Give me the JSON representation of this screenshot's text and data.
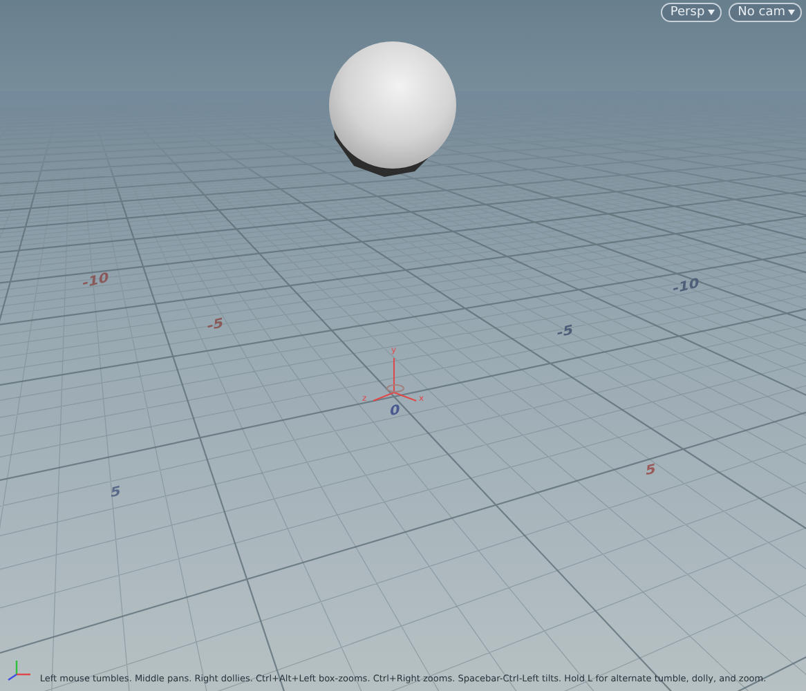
{
  "view_menus": [
    {
      "label": "Persp"
    },
    {
      "label": "No cam"
    }
  ],
  "grid_labels": [
    {
      "text": "-10",
      "color": "#8a5a5a"
    },
    {
      "text": "-5",
      "color": "#8a5a5a"
    },
    {
      "text": "5",
      "color": "#9a5a5a"
    },
    {
      "text": "-10",
      "color": "#4f5f7a"
    },
    {
      "text": "-5",
      "color": "#4f5f7a"
    },
    {
      "text": "5",
      "color": "#5a6a8a"
    },
    {
      "text": "0",
      "color": "#4a5a90"
    }
  ],
  "origin_axes": [
    {
      "text": "y"
    },
    {
      "text": "x"
    },
    {
      "text": "z"
    }
  ],
  "hint": "Left mouse tumbles. Middle pans. Right dollies. Ctrl+Alt+Left box-zooms. Ctrl+Right zooms. Spacebar-Ctrl-Left tilts. Hold L for alternate tumble, dolly, and zoom."
}
